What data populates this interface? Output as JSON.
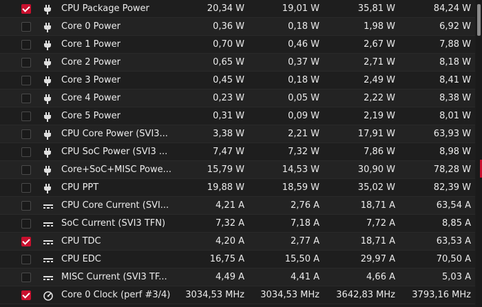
{
  "rows": [
    {
      "checked": true,
      "icon": "power-plug-icon",
      "label": "CPU Package Power",
      "cur": "20,34 W",
      "min": "19,01 W",
      "avg": "35,81 W",
      "max": "84,24 W"
    },
    {
      "checked": false,
      "icon": "power-plug-icon",
      "label": "Core 0 Power",
      "cur": "0,36 W",
      "min": "0,18 W",
      "avg": "1,98 W",
      "max": "6,92 W"
    },
    {
      "checked": false,
      "icon": "power-plug-icon",
      "label": "Core 1 Power",
      "cur": "0,70 W",
      "min": "0,46 W",
      "avg": "2,67 W",
      "max": "7,88 W"
    },
    {
      "checked": false,
      "icon": "power-plug-icon",
      "label": "Core 2 Power",
      "cur": "0,65 W",
      "min": "0,37 W",
      "avg": "2,71 W",
      "max": "8,18 W"
    },
    {
      "checked": false,
      "icon": "power-plug-icon",
      "label": "Core 3 Power",
      "cur": "0,45 W",
      "min": "0,18 W",
      "avg": "2,49 W",
      "max": "8,41 W"
    },
    {
      "checked": false,
      "icon": "power-plug-icon",
      "label": "Core 4 Power",
      "cur": "0,23 W",
      "min": "0,05 W",
      "avg": "2,22 W",
      "max": "8,38 W"
    },
    {
      "checked": false,
      "icon": "power-plug-icon",
      "label": "Core 5 Power",
      "cur": "0,31 W",
      "min": "0,09 W",
      "avg": "2,19 W",
      "max": "8,01 W"
    },
    {
      "checked": false,
      "icon": "power-plug-icon",
      "label": "CPU Core Power (SVI3...",
      "cur": "3,38 W",
      "min": "2,21 W",
      "avg": "17,91 W",
      "max": "63,93 W"
    },
    {
      "checked": false,
      "icon": "power-plug-icon",
      "label": "CPU SoC Power (SVI3 ...",
      "cur": "7,47 W",
      "min": "7,32 W",
      "avg": "7,86 W",
      "max": "8,98 W"
    },
    {
      "checked": false,
      "icon": "power-plug-icon",
      "label": "Core+SoC+MISC Powe...",
      "cur": "15,79 W",
      "min": "14,53 W",
      "avg": "30,90 W",
      "max": "78,28 W"
    },
    {
      "checked": false,
      "icon": "power-plug-icon",
      "label": "CPU PPT",
      "cur": "19,88 W",
      "min": "18,59 W",
      "avg": "35,02 W",
      "max": "82,39 W"
    },
    {
      "checked": false,
      "icon": "dc-current-icon",
      "label": "CPU Core Current (SVI...",
      "cur": "4,21 A",
      "min": "2,76 A",
      "avg": "18,71 A",
      "max": "63,54 A"
    },
    {
      "checked": false,
      "icon": "dc-current-icon",
      "label": "SoC Current (SVI3 TFN)",
      "cur": "7,32 A",
      "min": "7,18 A",
      "avg": "7,72 A",
      "max": "8,85 A"
    },
    {
      "checked": true,
      "icon": "dc-current-icon",
      "label": "CPU TDC",
      "cur": "4,20 A",
      "min": "2,77 A",
      "avg": "18,71 A",
      "max": "63,53 A"
    },
    {
      "checked": false,
      "icon": "dc-current-icon",
      "label": "CPU EDC",
      "cur": "16,75 A",
      "min": "15,50 A",
      "avg": "29,97 A",
      "max": "70,50 A"
    },
    {
      "checked": false,
      "icon": "dc-current-icon",
      "label": "MISC Current (SVI3 TF...",
      "cur": "4,49 A",
      "min": "4,41 A",
      "avg": "4,66 A",
      "max": "5,03 A"
    },
    {
      "checked": true,
      "icon": "gauge-icon",
      "label": "Core 0 Clock (perf #3/4)",
      "cur": "3034,53 MHz",
      "min": "3034,53 MHz",
      "avg": "3642,83 MHz",
      "max": "3793,16 MHz"
    }
  ],
  "colors": {
    "accent": "#c8102e",
    "background": "#1c1c1c",
    "text": "#e8e8e8"
  }
}
